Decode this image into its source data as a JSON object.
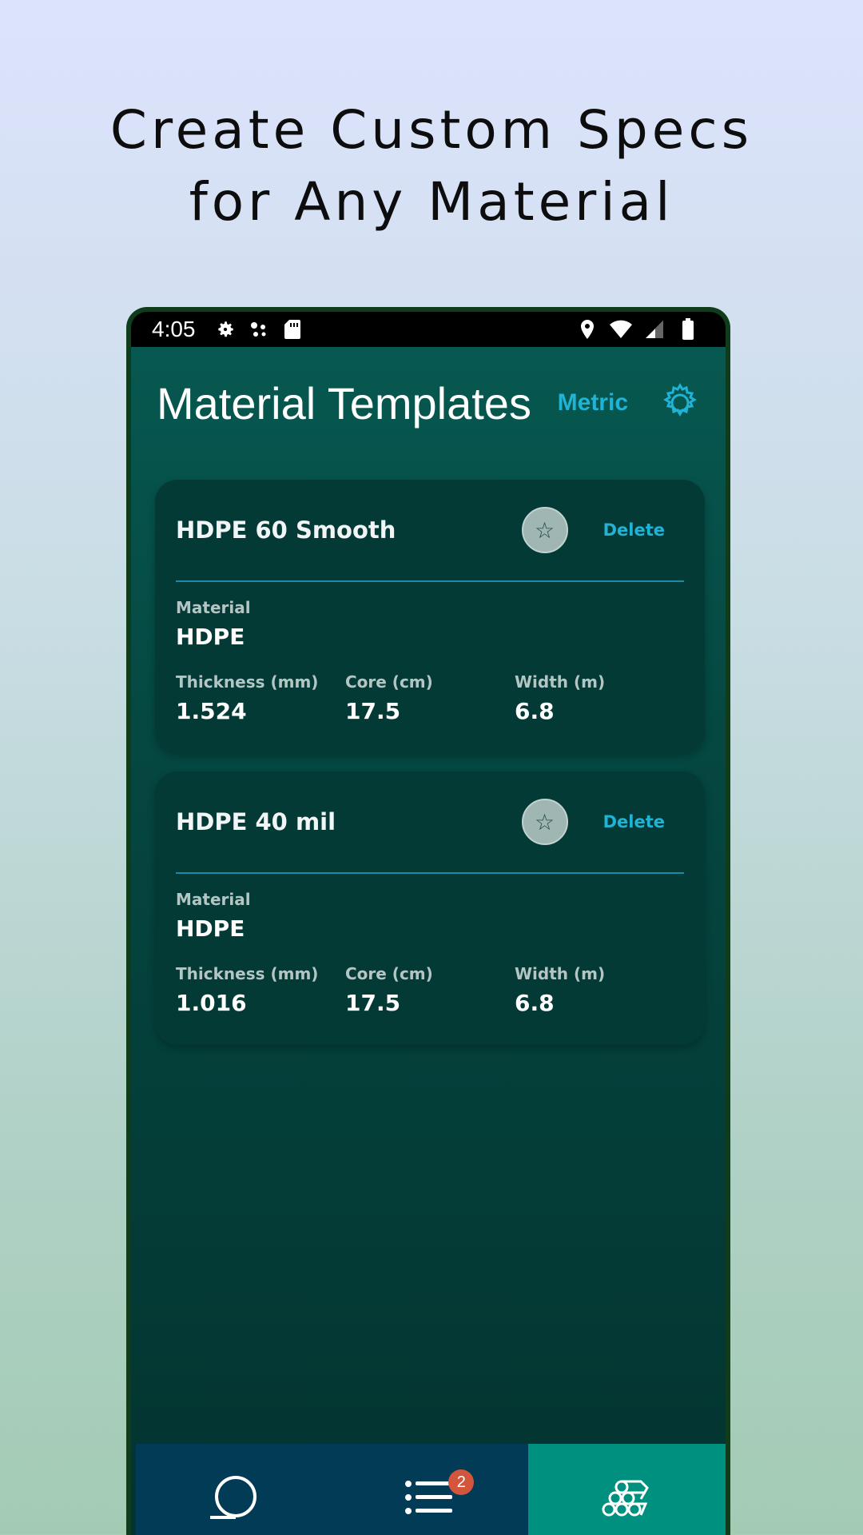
{
  "headline": {
    "line1": "Create Custom Specs",
    "line2": "for Any Material"
  },
  "status_bar": {
    "time": "4:05",
    "left_icons": [
      "settings-icon",
      "assistant-dots-icon",
      "sd-card-icon"
    ],
    "right_icons": [
      "location-icon",
      "wifi-icon",
      "cell-signal-icon",
      "battery-icon"
    ]
  },
  "app_bar": {
    "title": "Material Templates",
    "unit_toggle": "Metric",
    "settings_icon": "gear-icon"
  },
  "templates": [
    {
      "name": "HDPE 60 Smooth",
      "favorite_icon": "☆",
      "delete_label": "Delete",
      "material_label": "Material",
      "material": "HDPE",
      "stats": [
        {
          "label": "Thickness (mm)",
          "value": "1.524"
        },
        {
          "label": "Core (cm)",
          "value": "17.5"
        },
        {
          "label": "Width (m)",
          "value": "6.8"
        }
      ]
    },
    {
      "name": "HDPE 40 mil",
      "favorite_icon": "☆",
      "delete_label": "Delete",
      "material_label": "Material",
      "material": "HDPE",
      "stats": [
        {
          "label": "Thickness (mm)",
          "value": "1.016"
        },
        {
          "label": "Core (cm)",
          "value": "17.5"
        },
        {
          "label": "Width (m)",
          "value": "6.8"
        }
      ]
    }
  ],
  "bottom_nav": {
    "items": [
      {
        "icon": "roll-icon",
        "active": false
      },
      {
        "icon": "list-icon",
        "badge": "2",
        "active": false
      },
      {
        "icon": "pipes-stack-icon",
        "active": true
      }
    ]
  },
  "colors": {
    "accent": "#1fb3d6",
    "screen_bg": "#054741",
    "card_bg": "#033a36",
    "nav_bg": "#013b56",
    "nav_active": "#00907f",
    "badge": "#d3553c"
  }
}
